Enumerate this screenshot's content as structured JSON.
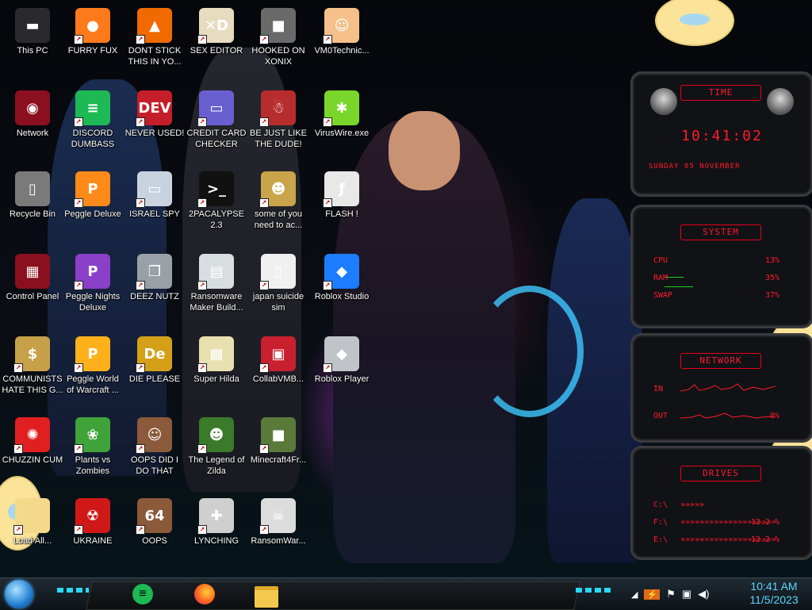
{
  "desktop": {
    "wallpaper_text": "",
    "icons": [
      {
        "label": "This PC",
        "icon": "computer-icon",
        "bg": "#2a2a2e",
        "glyph": "▬"
      },
      {
        "label": "FURRY FUX",
        "icon": "firefox-icon",
        "bg": "#ff7a1a",
        "glyph": "●"
      },
      {
        "label": "DONT STICK THIS IN YO...",
        "icon": "traffic-cone-icon",
        "bg": "#f06a00",
        "glyph": "▲"
      },
      {
        "label": "SEX EDITOR",
        "icon": "editor-icon",
        "bg": "#e8dcc0",
        "glyph": "✕D"
      },
      {
        "label": "HOOKED ON XONIX",
        "icon": "xonix-icon",
        "bg": "#6a6a6a",
        "glyph": "■"
      },
      {
        "label": "VM0Technic...",
        "icon": "technician-icon",
        "bg": "#f5c08a",
        "glyph": "☺"
      },
      {
        "label": "Network",
        "icon": "network-icon",
        "bg": "#8a1020",
        "glyph": "◉"
      },
      {
        "label": "DISCORD DUMBASS",
        "icon": "spotify-icon",
        "bg": "#1db954",
        "glyph": "≡"
      },
      {
        "label": "NEVER USED!",
        "icon": "devcpp-icon",
        "bg": "#c41e2a",
        "glyph": "DEV"
      },
      {
        "label": "CREDIT CARD CHECKER",
        "icon": "credit-card-icon",
        "bg": "#6a5fd0",
        "glyph": "▭"
      },
      {
        "label": "BE JUST LIKE THE DUDE!",
        "icon": "santa-icon",
        "bg": "#b72d2d",
        "glyph": "☃"
      },
      {
        "label": "VirusWire.exe",
        "icon": "lime-icon",
        "bg": "#7ad62a",
        "glyph": "✱"
      },
      {
        "label": "Recycle Bin",
        "icon": "recycle-bin-icon",
        "bg": "#7a7a7a",
        "glyph": "▯"
      },
      {
        "label": "Peggle Deluxe",
        "icon": "peggle-icon",
        "bg": "#ff8a1a",
        "glyph": "P"
      },
      {
        "label": "ISRAEL SPY",
        "icon": "spy-icon",
        "bg": "#c9d3e0",
        "glyph": "▭"
      },
      {
        "label": "2PACALYPSE 2.3",
        "icon": "terminal-icon",
        "bg": "#111",
        "glyph": ">_"
      },
      {
        "label": "some of you need to ac...",
        "icon": "beaver-icon",
        "bg": "#c9a44a",
        "glyph": "☻"
      },
      {
        "label": "FLASH !",
        "icon": "flash-icon",
        "bg": "#e8e8e8",
        "glyph": "ƒ"
      },
      {
        "label": "Control Panel",
        "icon": "control-panel-icon",
        "bg": "#8a1020",
        "glyph": "▦"
      },
      {
        "label": "Peggle Nights Deluxe",
        "icon": "peggle-nights-icon",
        "bg": "#8a40c8",
        "glyph": "P"
      },
      {
        "label": "DEEZ NUTZ",
        "icon": "windows-stack-icon",
        "bg": "#9aa0a8",
        "glyph": "❐"
      },
      {
        "label": "Ransomware Maker Build...",
        "icon": "window-app-icon",
        "bg": "#d8dde0",
        "glyph": "▤"
      },
      {
        "label": "japan suicide sim",
        "icon": "document-icon",
        "bg": "#f0f0f0",
        "glyph": "▯"
      },
      {
        "label": "Roblox Studio",
        "icon": "roblox-studio-icon",
        "bg": "#1d7dff",
        "glyph": "◆"
      },
      {
        "label": "COMMUNISTS HATE THIS G...",
        "icon": "money-bag-icon",
        "bg": "#c7a04a",
        "glyph": "$"
      },
      {
        "label": "Peggle World of Warcraft ...",
        "icon": "peggle-wow-icon",
        "bg": "#ffb01a",
        "glyph": "P"
      },
      {
        "label": "DIE PLEASE",
        "icon": "dreamweaver-icon",
        "bg": "#d4a017",
        "glyph": "De"
      },
      {
        "label": "Super Hilda",
        "icon": "pixel-art-icon",
        "bg": "#e8e0b0",
        "glyph": "▩"
      },
      {
        "label": "CollabVMB...",
        "icon": "collab-icon",
        "bg": "#c92030",
        "glyph": "▣"
      },
      {
        "label": "Roblox Player",
        "icon": "roblox-player-icon",
        "bg": "#c0c4c8",
        "glyph": "◆"
      },
      {
        "label": "CHUZZIN CUM",
        "icon": "chuzzle-icon",
        "bg": "#e02020",
        "glyph": "✺"
      },
      {
        "label": "Plants vs Zombies",
        "icon": "plants-icon",
        "bg": "#3fa33a",
        "glyph": "❀"
      },
      {
        "label": "OOPS DID I DO THAT",
        "icon": "portrait-icon",
        "bg": "#8a5a3a",
        "glyph": "☺"
      },
      {
        "label": "The Legend of Zilda",
        "icon": "zelda-icon",
        "bg": "#3a7a2a",
        "glyph": "☻"
      },
      {
        "label": "Minecraft4Fr...",
        "icon": "minecraft-icon",
        "bg": "#5a7a3a",
        "glyph": "■"
      },
      {
        "label": "Load All...",
        "icon": "star-character-icon",
        "bg": "#f5d98a",
        "glyph": ""
      },
      {
        "label": "UKRAINE",
        "icon": "radiation-icon",
        "bg": "#d01818",
        "glyph": "☢"
      },
      {
        "label": "OOPS",
        "icon": "portrait-64-icon",
        "bg": "#8a5a3a",
        "glyph": "64"
      },
      {
        "label": "LYNCHING",
        "icon": "virus-flag-icon",
        "bg": "#cfcfcf",
        "glyph": "✚"
      },
      {
        "label": "RansomWar...",
        "icon": "skull-icon",
        "bg": "#dcdcdc",
        "glyph": "☠"
      }
    ]
  },
  "widgets": {
    "time": {
      "header": "TIME",
      "clock": "10:41:02",
      "date": "SUNDAY 05 NOVEMBER"
    },
    "system": {
      "header": "SYSTEM",
      "rows": [
        {
          "label": "CPU",
          "value": "13%",
          "level": 0.13
        },
        {
          "label": "RAM",
          "value": "35%",
          "level": 0.35
        },
        {
          "label": "SWAP",
          "value": "37%",
          "level": 0.37
        }
      ]
    },
    "network": {
      "header": "NETWORK",
      "rows": [
        {
          "label": "IN",
          "value": ""
        },
        {
          "label": "OUT",
          "value": "0%"
        }
      ]
    },
    "drives": {
      "header": "DRIVES",
      "rows": [
        {
          "label": "C:\\",
          "value": ""
        },
        {
          "label": "F:\\",
          "value": "12.2 %"
        },
        {
          "label": "E:\\",
          "value": "12.2 %"
        }
      ]
    }
  },
  "taskbar": {
    "start_icon": "windows-orb-icon",
    "pinned": [
      {
        "icon": "spotify-icon",
        "color": "#1db954"
      },
      {
        "icon": "firefox-icon",
        "color": "#ff7a1a"
      },
      {
        "icon": "file-explorer-icon",
        "color": "#f2c94c"
      }
    ],
    "tray": [
      {
        "icon": "chevron-up-icon",
        "glyph": "⌃"
      },
      {
        "icon": "flash-tray-icon",
        "glyph": "⚡"
      },
      {
        "icon": "flag-icon",
        "glyph": "⚑"
      },
      {
        "icon": "network-tray-icon",
        "glyph": "▣"
      },
      {
        "icon": "volume-icon",
        "glyph": "🔊"
      }
    ],
    "time": "10:41 AM",
    "date": "11/5/2023"
  },
  "colors": {
    "accent": "#2bd8ff",
    "widget_red": "#ff1a2e",
    "clock": "#5bd5ff"
  }
}
